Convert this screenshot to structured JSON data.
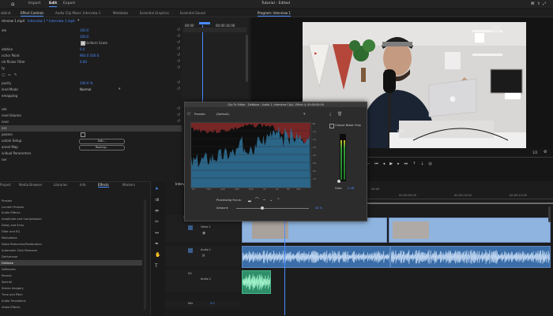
{
  "app": {
    "window_title": "Tutorial - Edited",
    "menu": [
      "Import",
      "Edit",
      "Export"
    ],
    "active_menu": "Edit"
  },
  "panel_tabs": [
    {
      "label": "dalind"
    },
    {
      "label": "Effect Controls",
      "active": true
    },
    {
      "label": "Audio Clip Mixer: Interview 1"
    },
    {
      "label": "Metadata"
    },
    {
      "label": "Essential Graphics"
    },
    {
      "label": "Essential Sound"
    }
  ],
  "effect_controls": {
    "source": "Interview 1 * Interview 1.mp4",
    "timecodes": [
      "00:00",
      "00:00:16:00"
    ],
    "rows": [
      {
        "label": "ale",
        "value": "100.0"
      },
      {
        "label": "",
        "value": "100.0"
      },
      {
        "label": "",
        "value": "Uniform Scale"
      },
      {
        "label": "otation",
        "value": "0.0"
      },
      {
        "label": "nchor Point",
        "value": "960.0   540.0"
      },
      {
        "label": "nti-flicker Filter",
        "value": "0.00"
      },
      {
        "label": "ty",
        "value": ""
      },
      {
        "label": "",
        "value": ""
      },
      {
        "label": "pacity",
        "value": "100.0 %"
      },
      {
        "label": "lend Mode",
        "value": "Normal"
      },
      {
        "label": "emapping",
        "value": ""
      },
      {
        "label": "",
        "value": ""
      },
      {
        "label": "ute",
        "value": ""
      },
      {
        "label": "nnel Volume",
        "value": ""
      },
      {
        "label": "nner",
        "value": ""
      },
      {
        "label": "ass",
        "value": ""
      },
      {
        "label": "passes",
        "value": ""
      },
      {
        "label": "ustom Setup",
        "value": "Edit..."
      },
      {
        "label": "annel Map",
        "value": "Routing..."
      },
      {
        "label": "ividual Parameters",
        "value": ""
      },
      {
        "label": "ner",
        "value": ""
      }
    ]
  },
  "audio_dialog": {
    "title": "Clip Fx Editor - DeNoise : Audio 1, Interview Clip1, Effect 4, 00:00:00:00",
    "presets_label": "Presets:",
    "preset_value": "(Default)",
    "output_noise_only": "Output Noise Only",
    "processing_focus": "Processing Focus:",
    "amount_label": "Amount:",
    "amount_value": "40 %",
    "gain_label": "Gain:",
    "gain_value": "0 dB",
    "freq_labels": [
      "Hz",
      "100",
      "200",
      "400",
      "800",
      "2k",
      "4k",
      "8k",
      "16k",
      "Hz"
    ],
    "db_labels": [
      "dB",
      "-10",
      "-20",
      "-30",
      "-40",
      "-50",
      "-60",
      "-70",
      "-80"
    ]
  },
  "program_monitor": {
    "title": "Program: Interview 1",
    "timecode": "00:00:00:00",
    "fit": "1/2",
    "frame_rate": ""
  },
  "effects_panel": {
    "tabs": [
      "Project",
      "Media Browser",
      "Libraries",
      "Info",
      "Effects",
      "Markers"
    ],
    "active_tab": "Effects",
    "items": [
      "Presets",
      "Lumetri Presets",
      "Audio Effects",
      "Amplitude and Compression",
      "Delay and Echo",
      "Filter and EQ",
      "Modulation",
      "Noise Reduction/Restoration",
      "Automatic Click Remover",
      "DeHummer",
      "DeNoise",
      "DeReverb",
      "Reverb",
      "Special",
      "Stereo Imagery",
      "Time and Pitch",
      "Audio Transitions",
      "Video Effects"
    ],
    "selected_item": "DeNoise"
  },
  "timeline": {
    "tab": "Interview 1",
    "timecode": "00:00:00:00",
    "ruler": [
      "00:00",
      "00:00:05:00",
      "00:00:10:00",
      "00:00:15:00",
      "00:00:20:00"
    ],
    "tracks": [
      {
        "id": "V2",
        "name": "Video 2"
      },
      {
        "id": "V1",
        "name": "Video 1"
      },
      {
        "id": "A1",
        "name": "Audio 1"
      },
      {
        "id": "A2",
        "name": "Audio 2"
      },
      {
        "id": "Mix",
        "name": "Mix",
        "value": "0.0"
      }
    ],
    "clip_label": "Interview 1 [V]"
  },
  "colors": {
    "accent": "#4b8cff",
    "video_clip": "#8fb4df",
    "audio_clip": "#3b6ea8",
    "music_clip": "#2f8f6a"
  }
}
